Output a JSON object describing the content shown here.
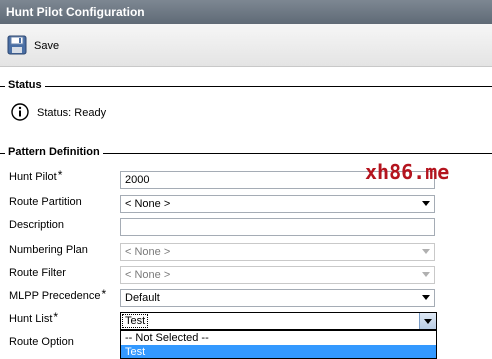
{
  "window": {
    "title": "Hunt Pilot Configuration"
  },
  "toolbar": {
    "save_label": "Save",
    "save_icon": "floppy-disk-icon"
  },
  "status_section": {
    "title": "Status",
    "status_text": "Status: Ready",
    "icon": "info-icon"
  },
  "pattern_section": {
    "title": "Pattern Definition",
    "fields": {
      "hunt_pilot": {
        "label": "Hunt Pilot",
        "required": "*",
        "value": "2000"
      },
      "route_partition": {
        "label": "Route Partition",
        "value": "< None >"
      },
      "description": {
        "label": "Description",
        "value": ""
      },
      "numbering_plan": {
        "label": "Numbering Plan",
        "value": "< None >"
      },
      "route_filter": {
        "label": "Route Filter",
        "value": "< None >"
      },
      "mlpp_precedence": {
        "label": "MLPP Precedence",
        "required": "*",
        "value": "Default"
      },
      "hunt_list": {
        "label": "Hunt List",
        "required": "*",
        "value": "Test",
        "options": [
          "-- Not Selected --",
          "Test"
        ],
        "highlighted_option": "Test"
      },
      "route_option": {
        "label": "Route Option"
      }
    }
  },
  "watermark": {
    "text": "xh86.me"
  },
  "colors": {
    "titlebar": "#6b7580",
    "selected_option": "#3399ff",
    "watermark": "#b4141e"
  }
}
